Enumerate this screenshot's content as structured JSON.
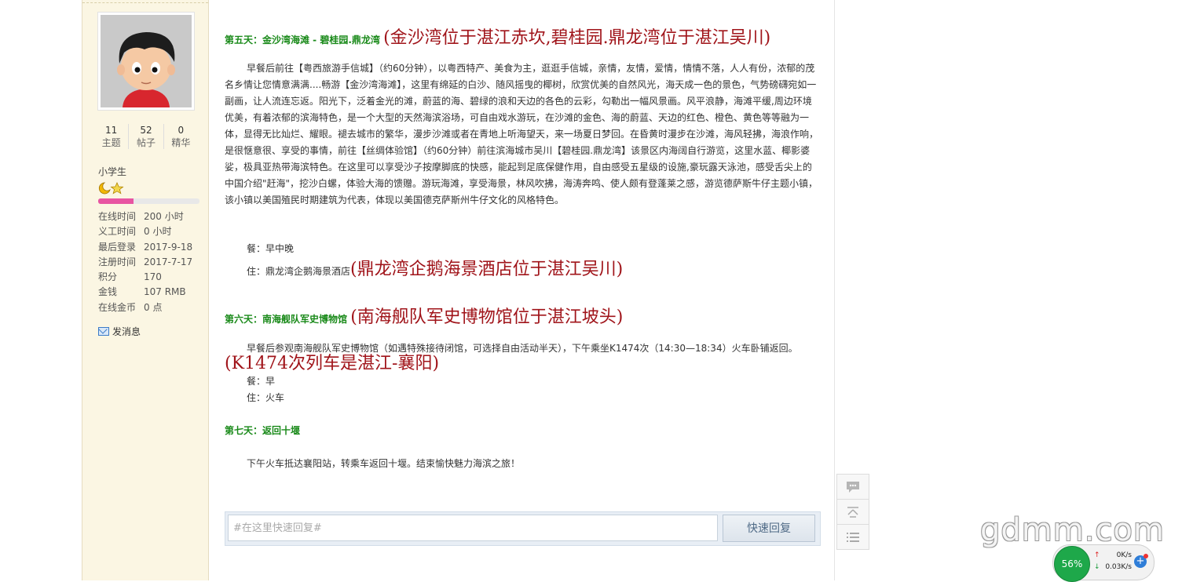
{
  "user": {
    "stats": [
      {
        "num": "11",
        "label": "主题"
      },
      {
        "num": "52",
        "label": "帖子"
      },
      {
        "num": "0",
        "label": "精华"
      }
    ],
    "rank": "小学生",
    "rank_progress": 0.35,
    "info": [
      {
        "k": "在线时间",
        "v": "200 小时"
      },
      {
        "k": "义工时间",
        "v": "0 小时"
      },
      {
        "k": "最后登录",
        "v": "2017-9-18"
      },
      {
        "k": "注册时间",
        "v": "2017-7-17"
      },
      {
        "k": "积分",
        "v": "170"
      },
      {
        "k": "金钱",
        "v": "107 RMB"
      },
      {
        "k": "在线金币",
        "v": "0 点"
      }
    ],
    "send_message": "发消息"
  },
  "post": {
    "day5": {
      "title": "第五天：金沙湾海滩 - 碧桂园.鼎龙湾",
      "note": "(金沙湾位于湛江赤坎,碧桂园.鼎龙湾位于湛江吴川)",
      "body": "早餐后前往【粤西旅游手信城】（约60分钟），以粤西特产、美食为主，逛逛手信城，亲情，友情，爱情，情情不落，人人有份，浓郁的茂名乡情让您情意满满....畅游【金沙湾海滩】，这里有绵延的白沙、随风摇曳的椰树，欣赏优美的自然风光，海天成一色的景色，气势磅礴宛如一副画，让人流连忘返。阳光下，泛着金光的滩，蔚蓝的海、碧绿的浪和天边的各色的云彩，勾勒出一幅风景画。风平浪静，海滩平缓,周边环境优美，有着浓郁的滨海特色，是一个大型的天然海滨浴场，可自由戏水游玩，在沙滩的金色、海的蔚蓝、天边的红色、橙色、黄色等等融为一体，显得无比灿烂、耀眼。褪去城市的繁华，漫步沙滩或者在青地上听海望天，来一场夏日梦回。在昏黄时漫步在沙滩，海风轻拂，海浪作响，是很惬意很、享受的事情，前往【丝绸体验馆】（约60分钟）前往滨海城市吴川【碧桂园.鼎龙湾】该景区内海阔自行游览，这里水蓝、椰影婆娑，极具亚热带海滨特色。在这里可以享受沙子按摩脚底的快感，能起到足底保健作用，自由感受五星级的设施,豪玩露天泳池，感受舌尖上的中国介绍\"赶海\"，挖沙白螺，体验大海的馈赠。游玩海滩，享受海景，林风吹拂，海涛奔鸣、使人颇有登蓬莱之感，游览德萨斯牛仔主题小镇，该小镇以美国殖民时期建筑为代表，体现以美国德克萨斯州牛仔文化的风格特色。",
      "meal": "餐：早中晚",
      "stay": "住：鼎龙湾企鹅海景酒店",
      "stay_note": "(鼎龙湾企鹅海景酒店位于湛江吴川)"
    },
    "day6": {
      "title": "第六天：南海舰队军史博物馆",
      "note": "(南海舰队军史博物馆位于湛江坡头)",
      "body": "早餐后参观南海舰队军史博物馆（如遇特殊接待闭馆，可选择自由活动半天），下午乘坐K1474次（14:30—18:34）火车卧铺返回。",
      "body_note": "(K1474次列车是湛江-襄阳)",
      "meal": "餐：早",
      "stay": "住：火车"
    },
    "day7": {
      "title": "第七天：返回十堰",
      "body": "下午火车抵达襄阳站，转乘车返回十堰。结束愉快魅力海滨之旅！"
    }
  },
  "reply": {
    "placeholder": "#在这里快速回复#",
    "button": "快速回复"
  },
  "watermark": "gdmm.com",
  "speed_widget": {
    "percent": "56%",
    "up": "0K/s",
    "down": "0.03K/s"
  }
}
